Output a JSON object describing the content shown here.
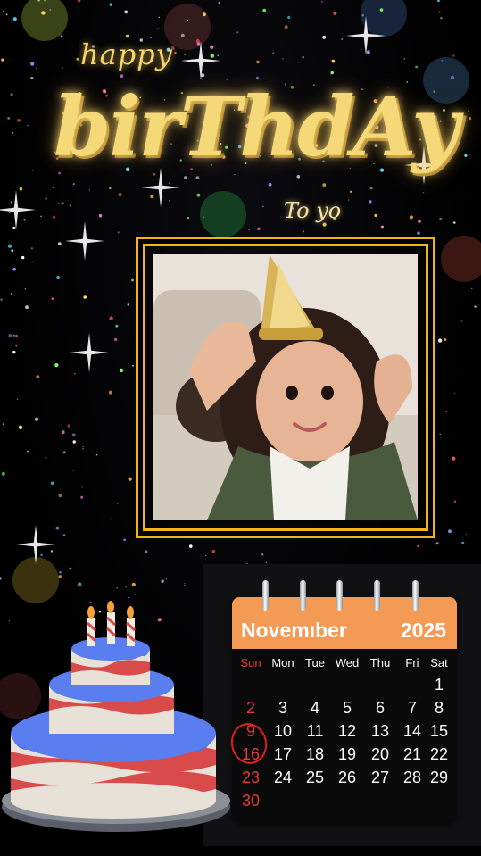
{
  "card": {
    "line1": "happy",
    "line2": "birThdAy",
    "line3": "To yo"
  },
  "calendar": {
    "month": "Novemıber",
    "year": "2025",
    "weekdays": [
      "Sun",
      "Mon",
      "Tue",
      "Wed",
      "Thu",
      "Fri",
      "Sat"
    ],
    "highlighted_day": "16",
    "days": [
      [
        "",
        "",
        "",
        "",
        "",
        "",
        "1"
      ],
      [
        "2",
        "3",
        "4",
        "5",
        "6",
        "7",
        "8"
      ],
      [
        "9",
        "10",
        "11",
        "12",
        "13",
        "14",
        "15"
      ],
      [
        "16",
        "17",
        "18",
        "19",
        "20",
        "21",
        "22"
      ],
      [
        "23",
        "24",
        "25",
        "26",
        "27",
        "28",
        "29"
      ],
      [
        "30",
        "",
        "",
        "",
        "",
        "",
        ""
      ]
    ]
  },
  "colors": {
    "gold": "#f5d878",
    "frame": "#f1b614",
    "calendar_header": "#f39a55",
    "sunday": "#e23a3a"
  }
}
